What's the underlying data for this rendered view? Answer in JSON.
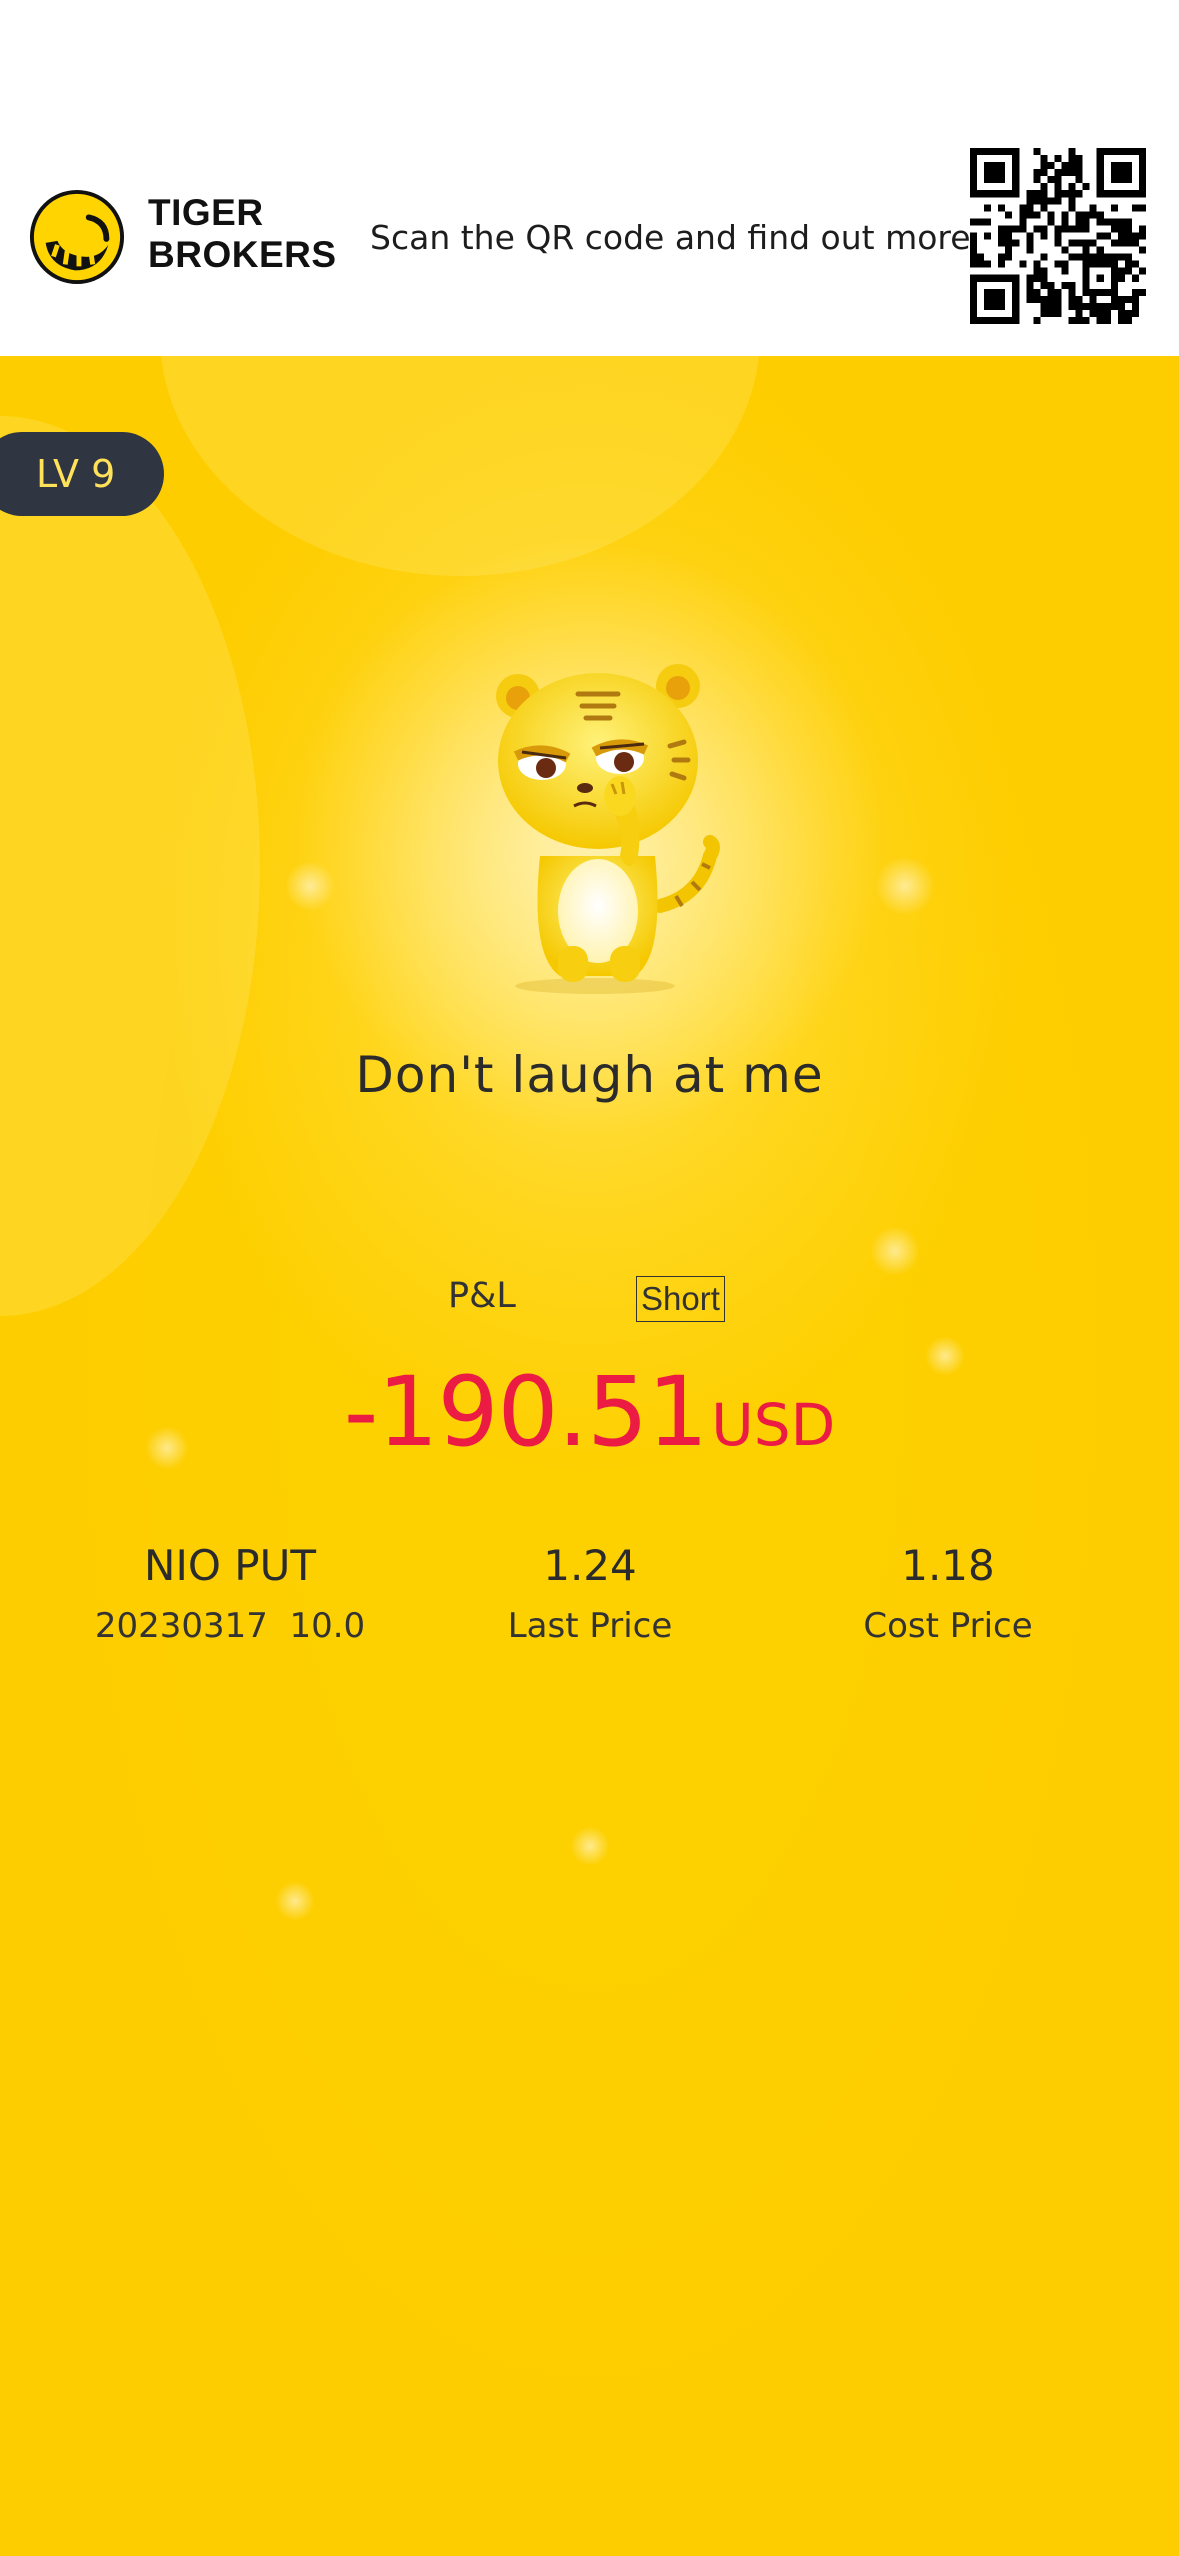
{
  "header": {
    "brand_line1": "TIGER",
    "brand_line2": "BROKERS",
    "scan_text": "Scan the QR code and find out more",
    "logo_icon": "tiger-brokers-logo",
    "qr_icon": "qr-code"
  },
  "card": {
    "level": "LV 9",
    "mascot_icon": "tiger-mascot-hand-on-mouth",
    "mood": "Don't laugh at me",
    "pnl_label": "P&L",
    "side_tag": "Short",
    "pnl_amount": "-190.51",
    "pnl_currency": "USD",
    "stats": {
      "symbol": "NIO PUT",
      "contract": "20230317  10.0",
      "last_price": "1.24",
      "last_price_label": "Last Price",
      "cost_price": "1.18",
      "cost_price_label": "Cost Price"
    }
  },
  "colors": {
    "card_yellow": "#fdd20a",
    "loss_red": "#ec1b44",
    "badge_dark": "#2f3541",
    "badge_text": "#ffe15a"
  }
}
